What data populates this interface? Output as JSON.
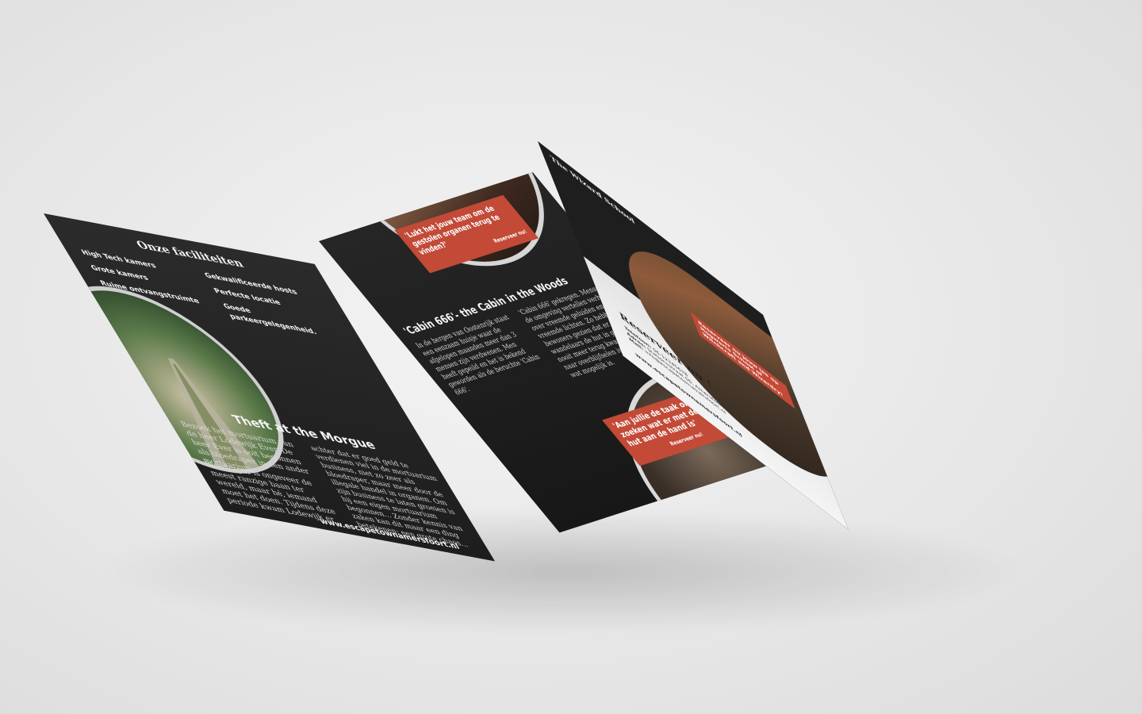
{
  "brochure": {
    "left": {
      "facilities_title": "Onze faciliteiten",
      "fac_items": [
        "High Tech kamers",
        "Grote kamers",
        "Ruime ontvangstruimte",
        "Gekwalificeerde hosts",
        "Perfecte locatie",
        "Goede parkeergelegenheid."
      ],
      "morgue_title": "Theft at the Morgue",
      "morgue_text_1": "Bezoek het mortuarium van de heer Lodewijk Ever. De heer Ever is ooit begonnen als bloedraper in een ander mortuarium.",
      "morgue_text_2": "Bloedraper is ongeveer de meest ranzige baan ter wereld, maar hé, iemand moet het doen. Tijdens deze periode kwam Lodewijk er",
      "morgue_text_3": "achter dat er goed geld te verdienen viel in de mortuarium business, niet zo zeer als bloedraper, maar meer door de illegale handel in organen. Om zijn business te laten groeien is hij een eigen mortuarium begonnen... Zonder kennis van zaken kan dit maar een ding betekenen; een grote chaos...",
      "website": "www.escapetownamersfoort.nl"
    },
    "middle": {
      "orange_top": "'Lukt het jouw team om de gestolen organen terug te vinden?'",
      "orange_top_cta": "Reserveer nu!",
      "cabin_title": "'Cabin 666'- the Cabin in the Woods",
      "cabin_text_1": "In de bergen van Oostenrijk staat een eenzaam huisje waar de afgelopen maanden meer dan 3 mensen zijn verdwenen. Men heeft gepeild en het is bekend geworden als de beruchte 'Cabin 666'.",
      "cabin_text_2": "'Cabin 666' gekregen. Mensen uit de omgeving vertellen verhalen over vreemde geluiden en zien vreemde lichten. Zo hebben bewoners gezien dat er wandelaars de hut in gingen maar nooit meer terug kwamen. Zoeken naar overblijfselen is het enige wat mogelijk is.",
      "orange_bottom": "'Aan jullie de taak om uit te zoeken wat er met deze hut aan de hand is'",
      "orange_bottom_cta": "Reserveer nu!"
    },
    "right": {
      "wizard_title": "The Wizard School",
      "orange_wizard": "Reserveer nu jouw les op Hogwarts School of Witchcraft and Wizardry!",
      "reserve_title": "Reserveer nu !",
      "tel_label": "Telefoon:",
      "tel_value": "06-12345678",
      "adres_label": "Adres:",
      "adres_value": "Stationsstraat 00, Amersfoort",
      "mail_label": "Mail:",
      "mail_value": "info@escapetownamersfoort.nl",
      "website": "www.escapetownamersfoort.nl"
    }
  }
}
